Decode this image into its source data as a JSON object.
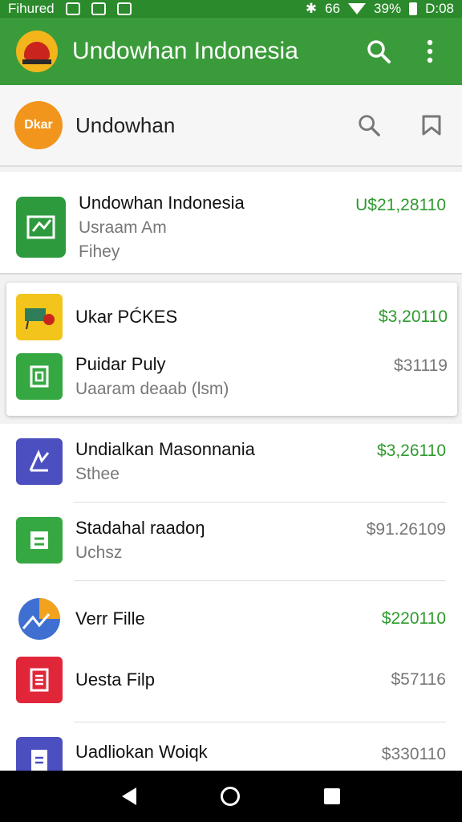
{
  "status_bar": {
    "carrier": "Fihured",
    "signal": "66",
    "battery": "39%",
    "time": "D:08"
  },
  "app_bar": {
    "title": "Undowhan Indonesia"
  },
  "search_row": {
    "avatar_text": "Dkar",
    "label": "Undowhan"
  },
  "colors": {
    "primary": "#3a9b3a",
    "status": "#2b8a2b",
    "accent_orange": "#f2951c",
    "amount_green": "#2e9a2e"
  },
  "featured": {
    "title": "Undowhan Indonesia",
    "subtitle": "Usraam Am",
    "meta": "Fihey",
    "amount": "U$21,28110",
    "icon": "sign-icon"
  },
  "group": [
    {
      "title": "Ukar PĆKES",
      "amount": "$3,20110",
      "icon": "cart-icon"
    },
    {
      "title": "Puidar Puly",
      "subtitle": "Uaaram deaab (lsm)",
      "amount": "$31119",
      "icon": "frame-icon"
    }
  ],
  "list": [
    {
      "title": "Undialkan Masonnania",
      "subtitle": "Sthee",
      "amount": "$3,26110",
      "icon": "chart-icon"
    },
    {
      "title": "Stadahal raadoŋ",
      "subtitle": "Uchsz",
      "amount": "$91.26109",
      "icon": "doc-icon"
    },
    {
      "title": "Verr Fille",
      "amount": "$220110",
      "icon": "pie-icon"
    },
    {
      "title": "Uesta Filp",
      "amount": "$57116",
      "icon": "form-icon"
    },
    {
      "title": "Uadliokan Woiqk",
      "amount": "$330110",
      "icon": "file-icon"
    }
  ]
}
